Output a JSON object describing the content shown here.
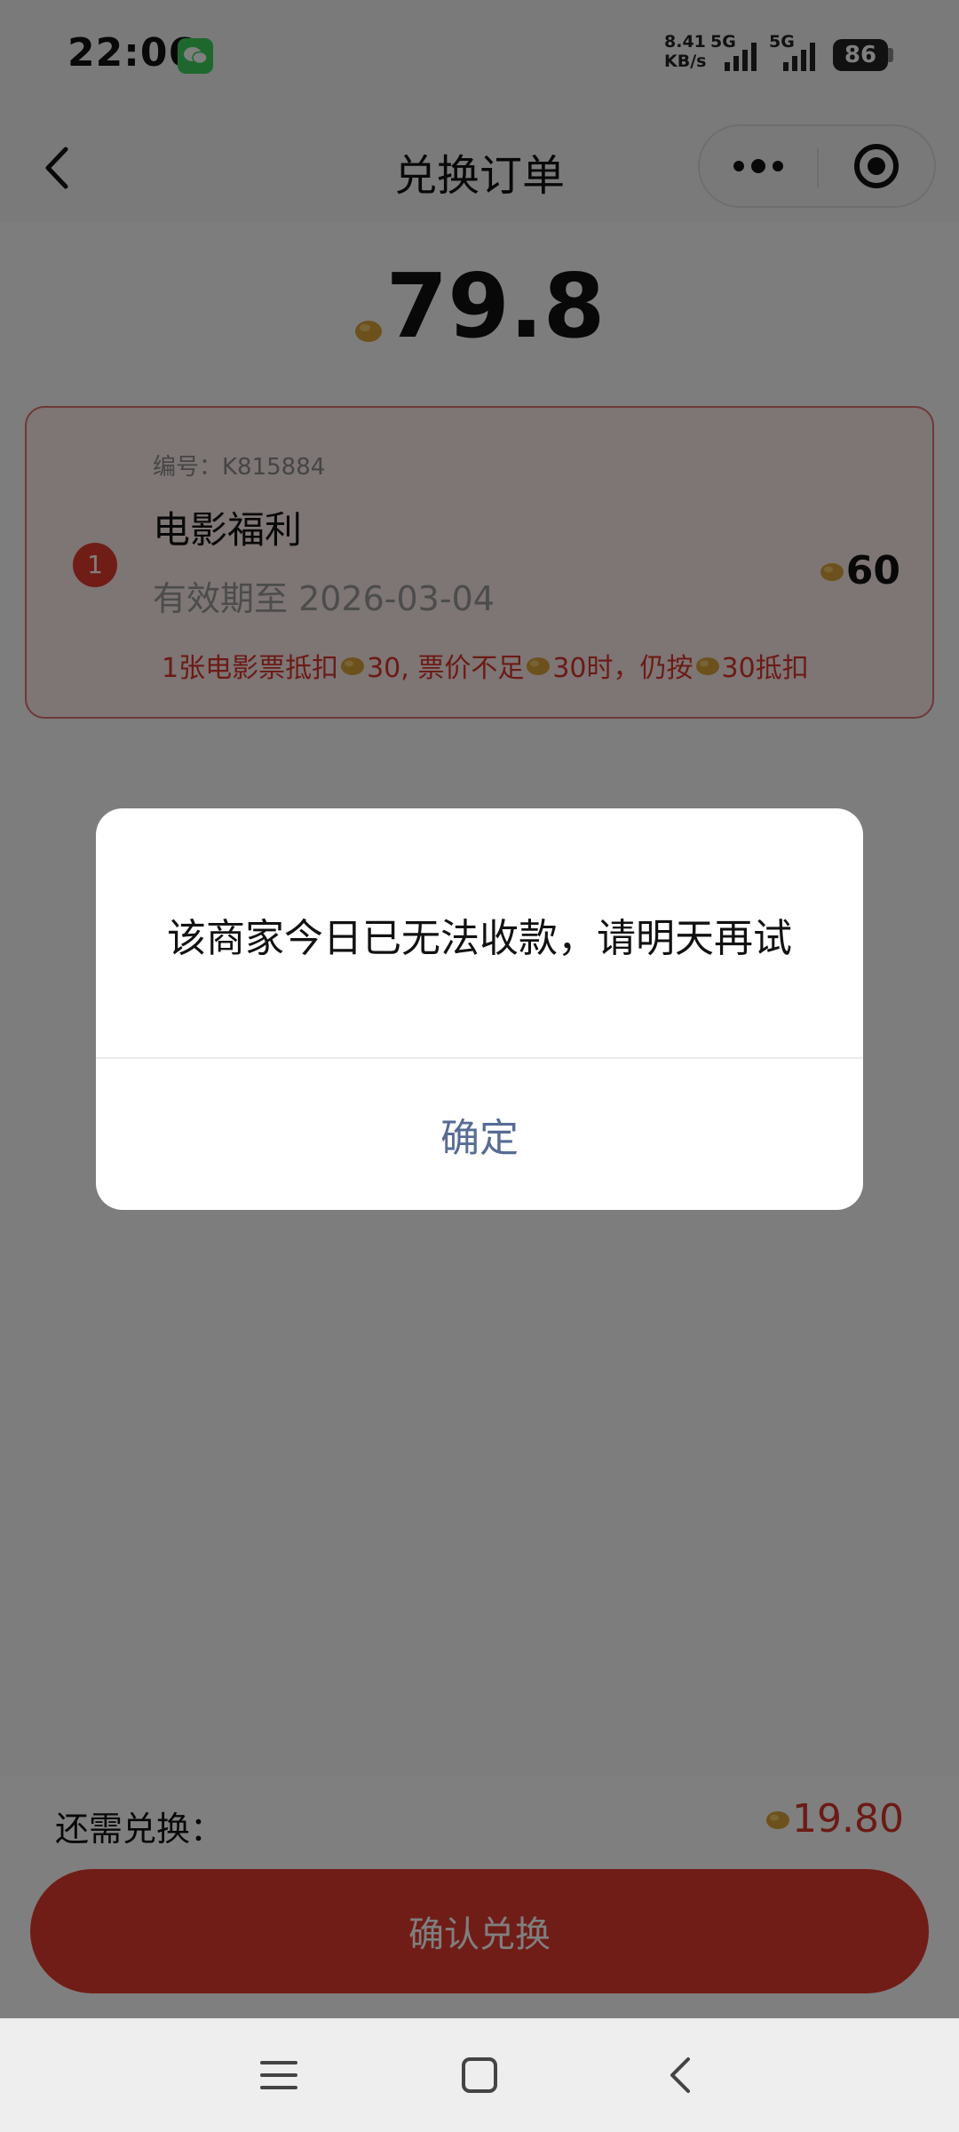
{
  "status_bar": {
    "time": "22:06",
    "net_speed_value": "8.41",
    "net_speed_unit": "KB/s",
    "sim1_label": "5G",
    "sim2_label": "5G",
    "battery": "86"
  },
  "header": {
    "title": "兑换订单",
    "more_icon": "more-dots-icon",
    "close_icon": "target-circle-icon"
  },
  "order": {
    "total": "79.8",
    "coupon": {
      "index": "1",
      "code": "编号：K815884",
      "title": "电影福利",
      "expiry": "有效期至 2026-03-04",
      "value": "60",
      "note_parts": [
        "1张电影票抵扣",
        "30, 票价不足",
        "30时，仍按",
        "30抵扣"
      ]
    }
  },
  "bottom": {
    "remaining_label": "还需兑换：",
    "remaining_value": "19.80",
    "confirm_label": "确认兑换"
  },
  "dialog": {
    "message": "该商家今日已无法收款，请明天再试",
    "ok_label": "确定"
  },
  "colors": {
    "accent_red": "#e03a2f",
    "bean_gold": "#d9a33a",
    "dialog_link": "#576b95"
  }
}
